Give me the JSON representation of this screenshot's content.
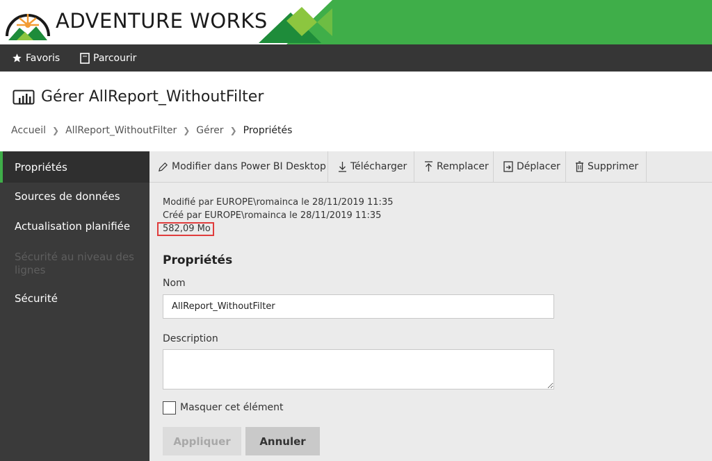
{
  "brand": {
    "title": "ADVENTURE WORKS",
    "colors": {
      "banner": "#3fae49",
      "dark_green": "#1e8c3a",
      "light_green": "#8cc63f",
      "accent_orange": "#f39c34"
    }
  },
  "nav": {
    "favorites": {
      "label": "Favoris",
      "icon": "star-icon"
    },
    "browse": {
      "label": "Parcourir",
      "icon": "document-icon"
    }
  },
  "header": {
    "title": "Gérer AllReport_WithoutFilter",
    "icon": "report-icon"
  },
  "breadcrumb": {
    "items": [
      "Accueil",
      "AllReport_WithoutFilter",
      "Gérer"
    ],
    "current": "Propriétés"
  },
  "sidebar": {
    "items": [
      {
        "label": "Propriétés",
        "state": "active"
      },
      {
        "label": "Sources de données",
        "state": "normal"
      },
      {
        "label": "Actualisation planifiée",
        "state": "normal"
      },
      {
        "label": "Sécurité au niveau des lignes",
        "state": "disabled"
      },
      {
        "label": "Sécurité",
        "state": "normal"
      }
    ],
    "accent_color": "#3fae49"
  },
  "toolbar": {
    "edit": "Modifier dans Power BI Desktop",
    "download": "Télécharger",
    "replace": "Remplacer",
    "move": "Déplacer",
    "delete": "Supprimer"
  },
  "meta": {
    "modified": "Modifié par EUROPE\\romainca le 28/11/2019 11:35",
    "created": "Créé par EUROPE\\romainca le 28/11/2019 11:35",
    "size": "582,09 Mo",
    "highlight_color": "#e03c3c"
  },
  "form": {
    "section_title": "Propriétés",
    "name_label": "Nom",
    "name_value": "AllReport_WithoutFilter",
    "description_label": "Description",
    "description_value": "",
    "hide_label": "Masquer cet élément",
    "hide_checked": false,
    "apply_label": "Appliquer",
    "cancel_label": "Annuler"
  }
}
